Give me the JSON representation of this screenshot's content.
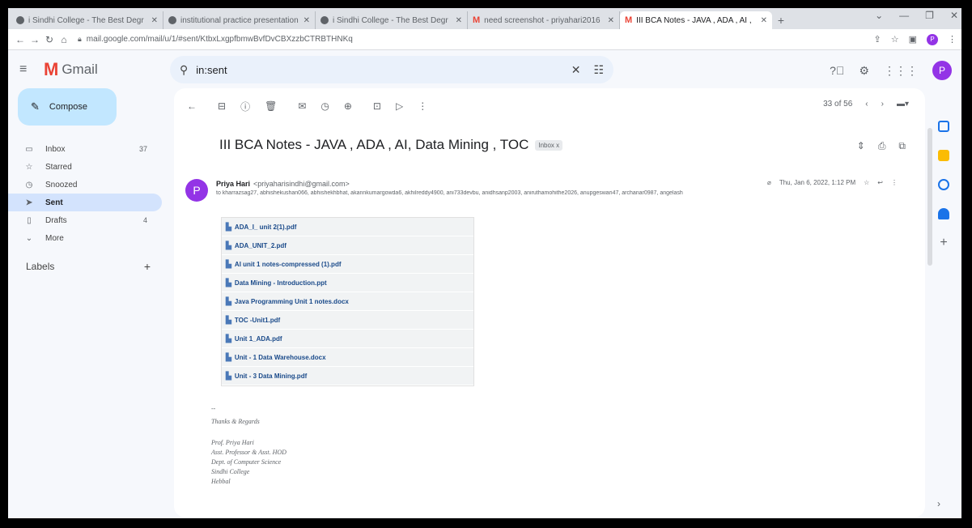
{
  "browser": {
    "tabs": [
      {
        "label": "i Sindhi College - The Best Degr",
        "active": false
      },
      {
        "label": "institutional practice presentation",
        "active": false
      },
      {
        "label": "i Sindhi College - The Best Degr",
        "active": false
      },
      {
        "label": "need screenshot - priyahari2016",
        "active": false
      },
      {
        "label": "III BCA Notes - JAVA , ADA , AI ,",
        "active": true
      }
    ],
    "url": "mail.google.com/mail/u/1/#sent/KtbxLxgpfbmwBvfDvCBXzzbCTRBTHNKq",
    "profile_initial": "P"
  },
  "gmail": {
    "brand": "Gmail",
    "search_query": "in:sent",
    "avatar_initial": "P"
  },
  "sidebar": {
    "compose_label": "Compose",
    "items": [
      {
        "label": "Inbox",
        "count": "37",
        "icon": "inbox-icon"
      },
      {
        "label": "Starred",
        "count": "",
        "icon": "star-icon"
      },
      {
        "label": "Snoozed",
        "count": "",
        "icon": "clock-icon"
      },
      {
        "label": "Sent",
        "count": "",
        "icon": "send-icon"
      },
      {
        "label": "Drafts",
        "count": "4",
        "icon": "draft-icon"
      },
      {
        "label": "More",
        "count": "",
        "icon": "chevron-down-icon"
      }
    ],
    "labels_heading": "Labels"
  },
  "toolbar": {
    "pagination": "33 of 56"
  },
  "message": {
    "subject": "III BCA Notes - JAVA , ADA , AI, Data Mining , TOC",
    "label_chip": "Inbox x",
    "sender_name": "Priya Hari",
    "sender_email": "<priyaharisindhi@gmail.com>",
    "recipients": "to kharrazsag27, abhishekushan066, abhishekhbhat, akannkumargowda6, akhilreddy4900, ani733devbu, anidhsanp2003, aniruthamohithe2026, anupgeswari47, archanar0987, angelash",
    "date": "Thu, Jan 6, 2022, 1:12 PM"
  },
  "attachments": [
    "ADA_I_ unit 2(1).pdf",
    "ADA_UNIT_2.pdf",
    "AI unit 1 notes-compressed (1).pdf",
    "Data Mining - Introduction.ppt",
    "Java Programming Unit 1 notes.docx",
    "TOC -Unit1.pdf",
    "Unit 1_ADA.pdf",
    "Unit - 1 Data Warehouse.docx",
    "Unit - 3 Data Mining.pdf"
  ],
  "signature": {
    "dash": "--",
    "thanks": "Thanks & Regards",
    "lines": [
      "Prof. Priya Hari",
      "Asst. Professor & Asst. HOD",
      "Dept. of Computer Science",
      "Sindhi College",
      "Hebbal"
    ]
  },
  "colors": {
    "accent": "#c2e7ff",
    "active_nav": "#d3e3fd",
    "avatar": "#9334e6",
    "gmail_red": "#ea4335"
  }
}
